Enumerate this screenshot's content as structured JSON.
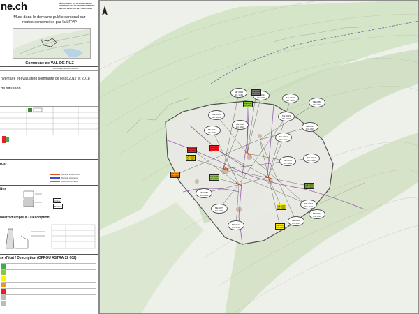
{
  "header": {
    "logo_text": "ne.ch",
    "department_lines": [
      "DÉPARTEMENT DU DÉVELOPPEMENT",
      "TERRITORIAL ET DE L'ENVIRONNEMENT",
      "SERVICE DES PONTS ET CHAUSSÉES"
    ],
    "title_lines": [
      "Murs dans le domaine public cantonal sur",
      "routes concernées par la LRVP"
    ],
    "commune": "Commune de VAL-DE-RUZ",
    "subtitle_lines": [
      "nventaire et évaluation sommaire de l'état 2017 et 2018"
    ],
    "plan_type": "de situation",
    "id_left": "1",
    "id_right": "Commune de VAL-DE-RUZ"
  },
  "legend": {
    "section_1": "rds",
    "section_1_items": [
      {
        "label": "Murs de soutènement",
        "color": "#e0531f"
      },
      {
        "label": "Murs de séparation",
        "color": "#3b4fd1"
      },
      {
        "label": "Routes principales",
        "color": "#9a6bb0"
      }
    ],
    "section_2": "ttes",
    "tag_1": "Arrière",
    "tag_2": "Bordure",
    "section_3": "ndard d'ampleur / Description",
    "section_4": "se d'état / Description (OFROU ASTRA 12 002)",
    "etat_colors": [
      "#3fae49",
      "#8cc63f",
      "#fff200",
      "#f7941d",
      "#ed1c24",
      "#bbbbbb",
      "#bbbbbb"
    ],
    "etat_hint": [
      "",
      "",
      "",
      "",
      "",
      "",
      ""
    ]
  },
  "map": {
    "gray_labels": [
      {
        "l1": "ME 0005",
        "l2": "RC 1315"
      },
      {
        "l1": "ME 0012",
        "l2": "RC 1320"
      },
      {
        "l1": "ME 0019",
        "l2": "RC 1320"
      },
      {
        "l1": "ME 0023",
        "l2": "RC 1003"
      },
      {
        "l1": "ME 0031",
        "l2": "RC 1003"
      },
      {
        "l1": "ME 0036",
        "l2": "RC 1003"
      },
      {
        "l1": "ME 0042",
        "l2": "RC 1003"
      },
      {
        "l1": "ME 0047",
        "l2": "RC 1311"
      },
      {
        "l1": "ME 0051",
        "l2": "RC 1311"
      },
      {
        "l1": "ME 0058",
        "l2": "RC 1311"
      },
      {
        "l1": "ME 0064",
        "l2": "RC 2000"
      },
      {
        "l1": "ME 0070",
        "l2": "RC 1003"
      },
      {
        "l1": "ME 0075",
        "l2": "RC 1003"
      },
      {
        "l1": "ME 0081",
        "l2": "RC 1003"
      },
      {
        "l1": "ME 0088",
        "l2": "RC 1003"
      },
      {
        "l1": "ME 0093",
        "l2": "RC 1310"
      },
      {
        "l1": "ME 0097",
        "l2": "RC 1310"
      },
      {
        "l1": "ME 0102",
        "l2": "RC 1310"
      }
    ],
    "color_labels": [
      {
        "l1": "ME 0003",
        "l2": "RC 1003",
        "color": "#ed1c24"
      },
      {
        "l1": "ME 0008",
        "l2": "RC 1003",
        "color": "#ed1c24"
      },
      {
        "l1": "ME 0014",
        "l2": "RC 1003",
        "color": "#f7941d"
      },
      {
        "l1": "ME 0026",
        "l2": "RC 1003",
        "color": "#fff200"
      },
      {
        "l1": "ME 0033",
        "l2": "RC 1003",
        "color": "#8cc63f"
      },
      {
        "l1": "ME 0045",
        "l2": "RC 1003",
        "color": "#8cc63f"
      },
      {
        "l1": "ME 0055",
        "l2": "RC 2000",
        "color": "#fff200"
      },
      {
        "l1": "ME 0067",
        "l2": "RC 1003",
        "color": "#fff200"
      },
      {
        "l1": "ME 0079",
        "l2": "RC 1310",
        "color": "#8cc63f"
      },
      {
        "l1": "ME 0091",
        "l2": "RC 1003",
        "color": "#777777"
      }
    ]
  }
}
